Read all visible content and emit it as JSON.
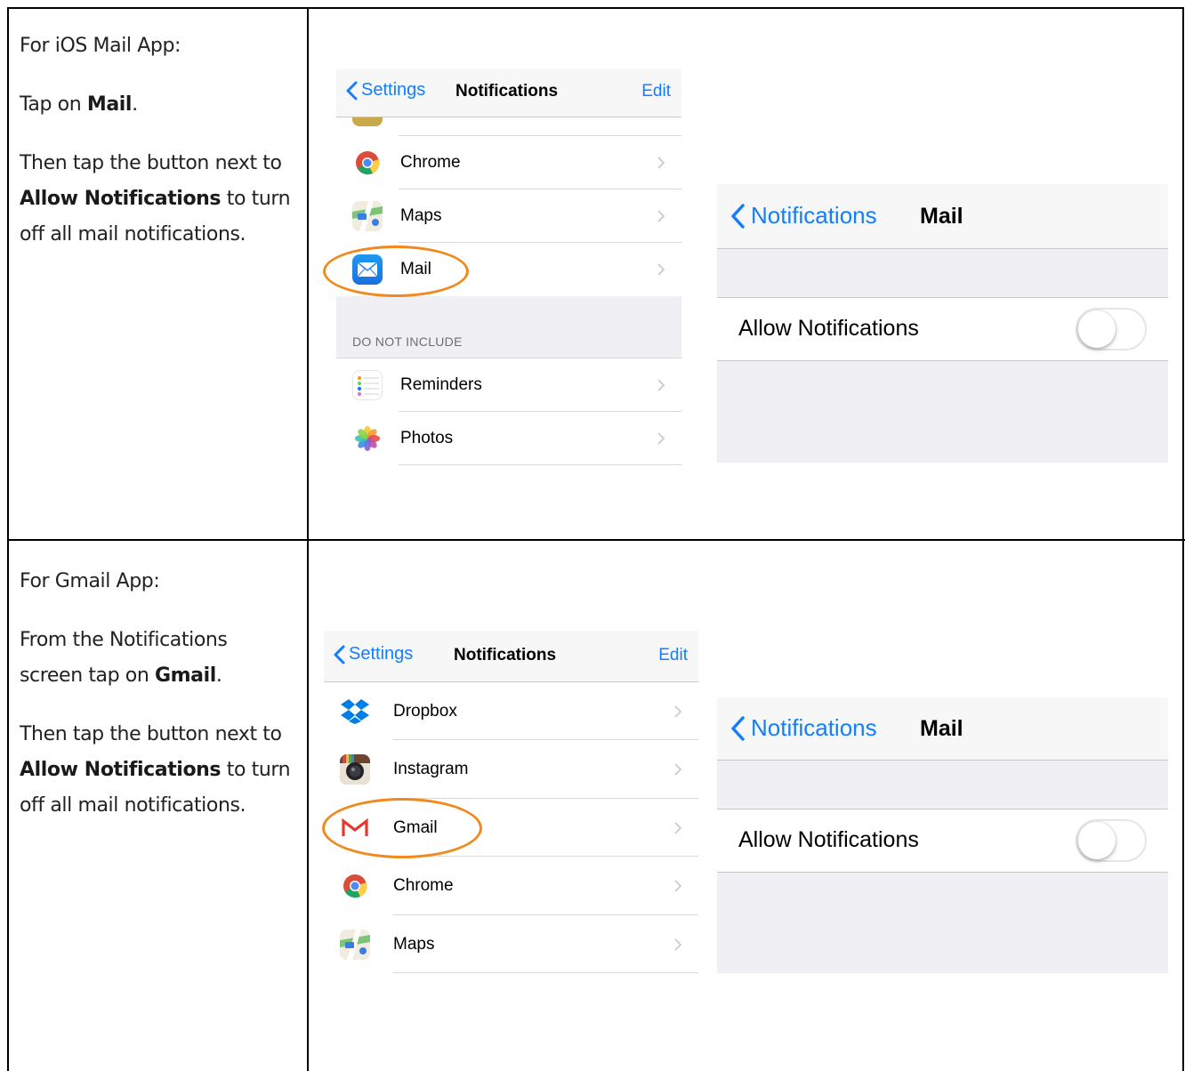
{
  "rows": [
    {
      "heading": "For iOS Mail App:",
      "steps": [
        {
          "before": "Tap on ",
          "bold": "Mail",
          "after": "."
        },
        {
          "before": "Then tap the button next to ",
          "bold": "Allow Notifications",
          "after": " to turn off all mail notifications."
        }
      ],
      "list_screen": {
        "back_label": "Settings",
        "title": "Notifications",
        "edit_label": "Edit",
        "items": [
          {
            "label": "Chrome",
            "icon": "chrome-icon"
          },
          {
            "label": "Maps",
            "icon": "maps-icon"
          },
          {
            "label": "Mail",
            "icon": "mail-icon"
          }
        ],
        "section_header": "DO NOT INCLUDE",
        "excluded_items": [
          {
            "label": "Reminders",
            "icon": "reminders-icon"
          },
          {
            "label": "Photos",
            "icon": "photos-icon"
          }
        ]
      },
      "detail_screen": {
        "back_label": "Notifications",
        "title": "Mail",
        "setting_label": "Allow Notifications",
        "toggle_on": false
      }
    },
    {
      "heading": "For Gmail App:",
      "steps": [
        {
          "before": "From the Notifications screen tap on ",
          "bold": "Gmail",
          "after": "."
        },
        {
          "before": "Then tap the button next to ",
          "bold": "Allow Notifications",
          "after": " to turn off all mail notifications."
        }
      ],
      "list_screen": {
        "back_label": "Settings",
        "title": "Notifications",
        "edit_label": "Edit",
        "items": [
          {
            "label": "Dropbox",
            "icon": "dropbox-icon"
          },
          {
            "label": "Instagram",
            "icon": "instagram-icon"
          },
          {
            "label": "Gmail",
            "icon": "gmail-icon"
          },
          {
            "label": "Chrome",
            "icon": "chrome-icon"
          },
          {
            "label": "Maps",
            "icon": "maps-icon"
          }
        ]
      },
      "detail_screen": {
        "back_label": "Notifications",
        "title": "Mail",
        "setting_label": "Allow Notifications",
        "toggle_on": false
      }
    }
  ],
  "colors": {
    "ios_blue": "#147efb",
    "highlight_orange": "#ef8a1e",
    "group_background": "#efeff4"
  }
}
